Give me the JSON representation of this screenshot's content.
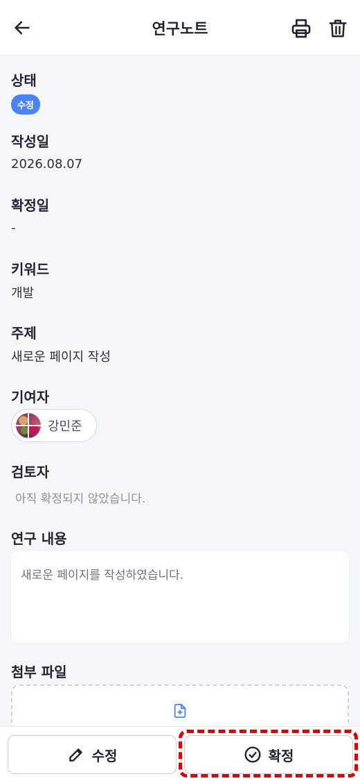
{
  "header": {
    "title": "연구노트",
    "back_icon": "arrow-left-icon",
    "print_icon": "printer-icon",
    "delete_icon": "trash-icon"
  },
  "fields": {
    "status": {
      "label": "상태",
      "badge": "수정",
      "badge_color": "#4b83f6"
    },
    "created": {
      "label": "작성일",
      "value": "2026.08.07"
    },
    "confirmed": {
      "label": "확정일",
      "value": "-"
    },
    "keyword": {
      "label": "키워드",
      "value": "개발"
    },
    "subject": {
      "label": "주제",
      "value": "새로운 페이지 작성"
    },
    "contributor": {
      "label": "기여자",
      "name": "강민준"
    },
    "reviewer": {
      "label": "검토자",
      "value": "아직 확정되지 않았습니다."
    },
    "content": {
      "label": "연구 내용",
      "value": "새로운 페이지를 작성하였습니다."
    },
    "attachment": {
      "label": "첨부 파일",
      "icon": "file-plus-icon"
    }
  },
  "footer": {
    "edit_label": "수정",
    "edit_icon": "pencil-icon",
    "confirm_label": "확정",
    "confirm_icon": "check-circle-icon",
    "highlight_color": "#e00000"
  }
}
